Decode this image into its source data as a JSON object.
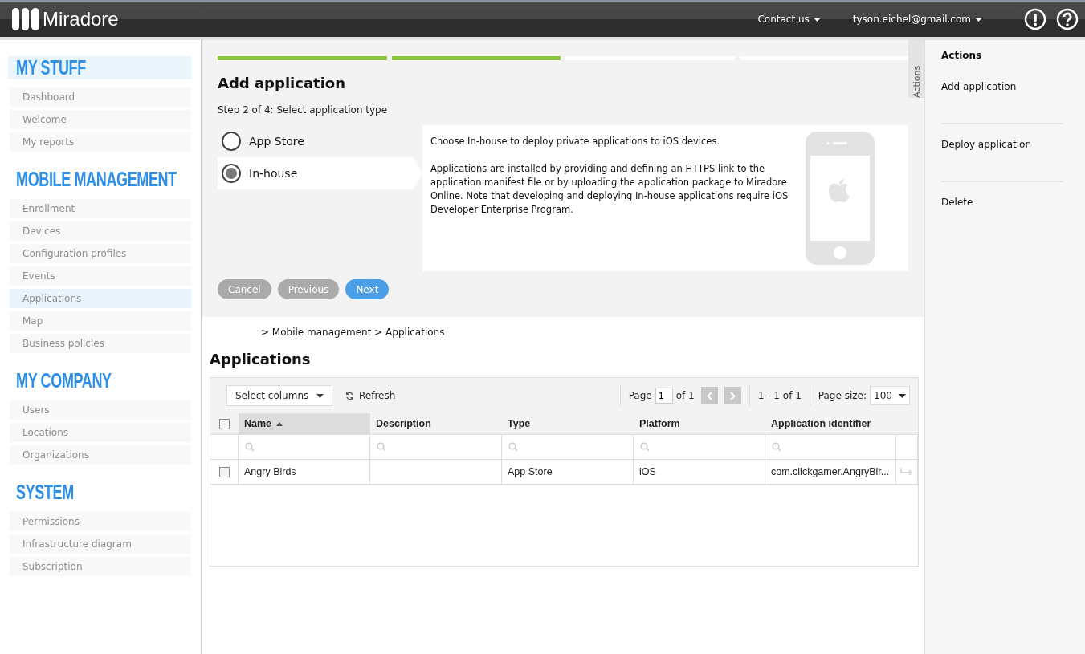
{
  "header": {
    "logo": "Miradore",
    "menus": [
      {
        "label": "Contact us"
      },
      {
        "label": "tyson.eichel@gmail.com"
      }
    ]
  },
  "sidebar": {
    "sections": [
      {
        "title": "MY STUFF",
        "selected": true,
        "items": [
          {
            "label": "Dashboard",
            "selected": false
          },
          {
            "label": "Welcome",
            "selected": false
          },
          {
            "label": "My reports",
            "selected": false
          }
        ]
      },
      {
        "title": "MOBILE MANAGEMENT",
        "selected": false,
        "items": [
          {
            "label": "Enrollment",
            "selected": false
          },
          {
            "label": "Devices",
            "selected": false
          },
          {
            "label": "Configuration profiles",
            "selected": false
          },
          {
            "label": "Events",
            "selected": false
          },
          {
            "label": "Applications",
            "selected": true
          },
          {
            "label": "Map",
            "selected": false
          },
          {
            "label": "Business policies",
            "selected": false
          }
        ]
      },
      {
        "title": "MY COMPANY",
        "selected": false,
        "items": [
          {
            "label": "Users",
            "selected": false
          },
          {
            "label": "Locations",
            "selected": false
          },
          {
            "label": "Organizations",
            "selected": false
          }
        ]
      },
      {
        "title": "SYSTEM",
        "selected": false,
        "items": [
          {
            "label": "Permissions",
            "selected": false
          },
          {
            "label": "Infrastructure diagram",
            "selected": false
          },
          {
            "label": "Subscription",
            "selected": false
          }
        ]
      }
    ]
  },
  "wizard": {
    "steps": [
      {
        "done": true
      },
      {
        "done": true
      },
      {
        "done": false
      },
      {
        "done": false
      }
    ],
    "title": "Add application",
    "subtitle": "Step 2 of 4: Select application type",
    "options": [
      {
        "label": "App Store",
        "selected": false
      },
      {
        "label": "In-house",
        "selected": true
      }
    ],
    "description": [
      "Choose In-house to deploy private applications to iOS devices.",
      "Applications are installed by providing and defining an HTTPS link to the application manifest file or by uploading the application package to Miradore Online. Note that developing and deploying In-house applications require iOS Developer Enterprise Program."
    ],
    "buttons": [
      {
        "label": "Cancel",
        "kind": "secondary"
      },
      {
        "label": "Previous",
        "kind": "secondary"
      },
      {
        "label": "Next",
        "kind": "primary"
      }
    ]
  },
  "actions_tab": "Actions",
  "breadcrumb": "> Mobile management > Applications",
  "page_title": "Applications",
  "toolbar": {
    "select_columns": "Select columns",
    "refresh": "Refresh",
    "page_label": "Page",
    "page": "1",
    "of": "of 1",
    "range": "1 - 1 of 1",
    "page_size_label": "Page size:",
    "page_size": "100"
  },
  "table": {
    "header_checked": false,
    "columns": [
      {
        "label": "Name",
        "sorted": true
      },
      {
        "label": "Description",
        "sorted": false
      },
      {
        "label": "Type",
        "sorted": false
      },
      {
        "label": "Platform",
        "sorted": false
      },
      {
        "label": "Application identifier",
        "sorted": false
      }
    ],
    "rows": [
      {
        "checked": false,
        "cells": [
          "Angry Birds",
          null,
          "App Store",
          "iOS",
          "com.clickgamer.AngryBir..."
        ]
      }
    ]
  },
  "actions": {
    "title": "Actions",
    "items": [
      "Add application",
      "Deploy application",
      "Delete"
    ]
  }
}
